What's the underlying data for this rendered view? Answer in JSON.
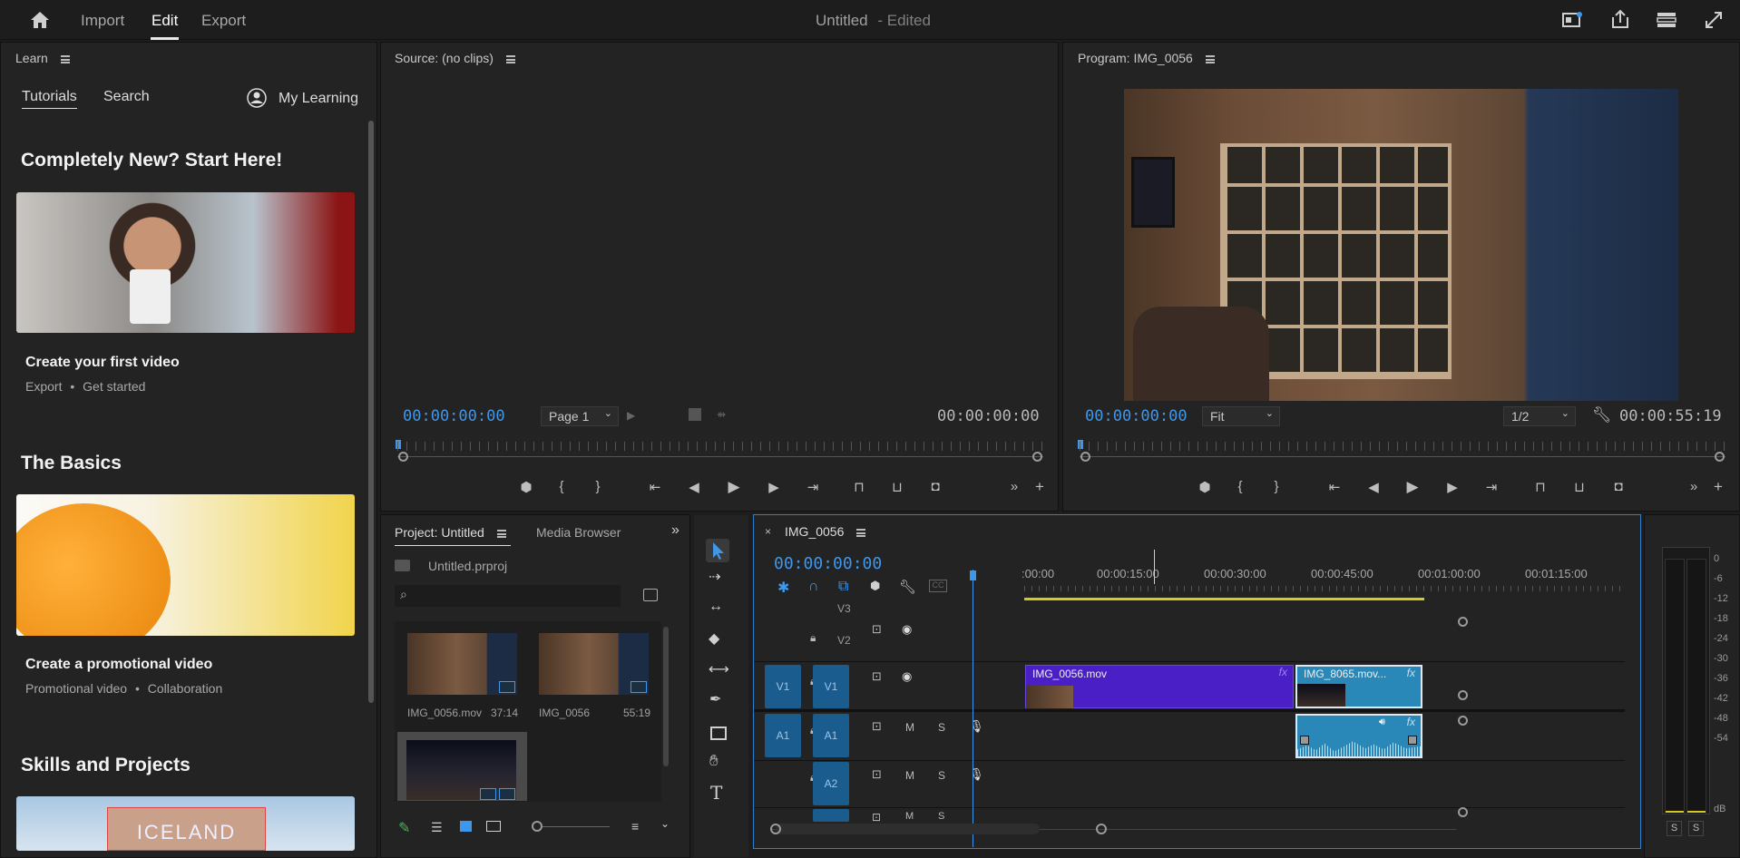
{
  "topbar": {
    "nav": [
      "Import",
      "Edit",
      "Export"
    ],
    "title": "Untitled",
    "title_status": "- Edited"
  },
  "learn": {
    "panel_title": "Learn",
    "tabs": [
      "Tutorials",
      "Search"
    ],
    "my_learning": "My Learning",
    "sections": [
      {
        "heading": "Completely New? Start Here!",
        "card_title": "Create your first video",
        "tags": [
          "Export",
          "Get started"
        ]
      },
      {
        "heading": "The Basics",
        "card_title": "Create a promotional video",
        "tags": [
          "Promotional video",
          "Collaboration"
        ]
      },
      {
        "heading": "Skills and Projects",
        "card_overlay": "ICELAND"
      }
    ]
  },
  "source": {
    "title": "Source: (no clips)",
    "timecode_in": "00:00:00:00",
    "page": "Page 1",
    "timecode_out": "00:00:00:00"
  },
  "program": {
    "title": "Program: IMG_0056",
    "timecode_in": "00:00:00:00",
    "zoom": "Fit",
    "resolution": "1/2",
    "duration": "00:00:55:19"
  },
  "project": {
    "tabs": [
      "Project: Untitled",
      "Media Browser"
    ],
    "file": "Untitled.prproj",
    "items": [
      {
        "name": "IMG_0056.mov",
        "duration": "37:14"
      },
      {
        "name": "IMG_0056",
        "duration": "55:19"
      }
    ]
  },
  "timeline": {
    "sequence": "IMG_0056",
    "timecode": "00:00:00:00",
    "ruler": [
      ":00:00",
      "00:00:15:00",
      "00:00:30:00",
      "00:00:45:00",
      "00:01:00:00",
      "00:01:15:00"
    ],
    "tracks": {
      "v3": "V3",
      "v2": "V2",
      "v1_src": "V1",
      "v1": "V1",
      "a1_src": "A1",
      "a1": "A1",
      "a2": "A2",
      "m": "M",
      "s": "S"
    },
    "clips": [
      "IMG_0056.mov",
      "IMG_8065.mov..."
    ],
    "fx": "fx"
  },
  "meter": {
    "labels": [
      "0",
      "-6",
      "-12",
      "-18",
      "-24",
      "-30",
      "-36",
      "-42",
      "-48",
      "-54",
      "dB"
    ],
    "solo": "S"
  },
  "colors": {
    "accent_blue": "#3f97ea",
    "video_clip": "#4b1fc6",
    "audio_clip": "#2a88b8",
    "track_button": "#1b5c8e",
    "playhead": "#3f97ea"
  }
}
